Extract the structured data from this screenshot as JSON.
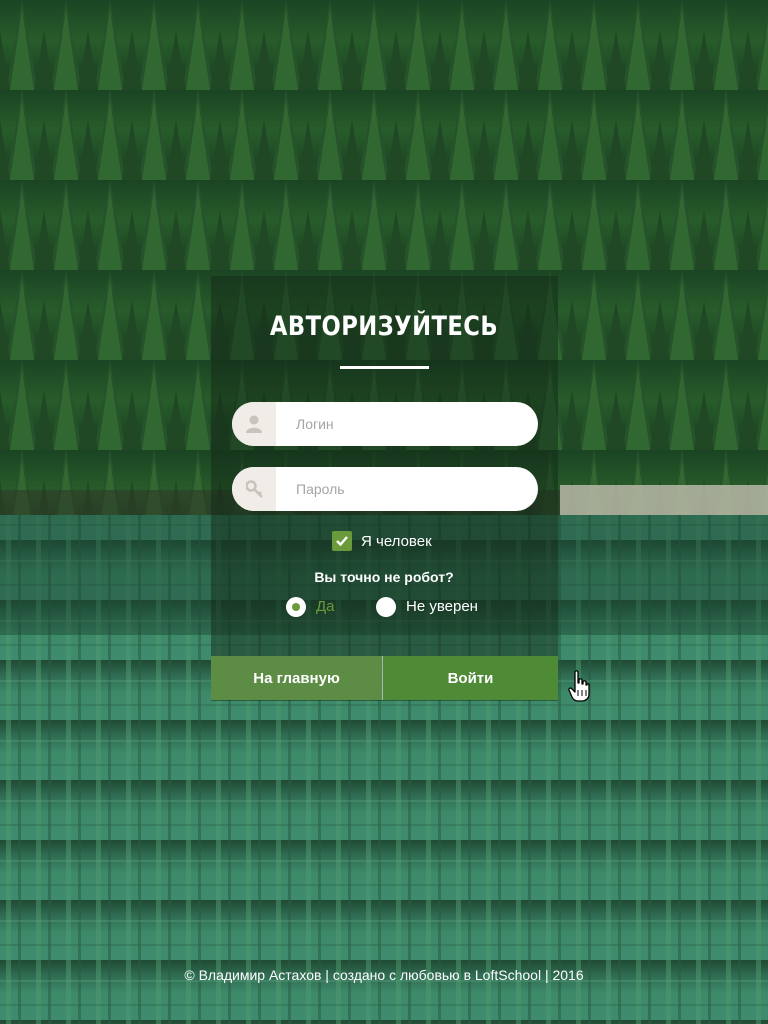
{
  "card": {
    "title": "АВТОРИЗУЙТЕСЬ"
  },
  "login_field": {
    "placeholder": "Логин",
    "value": "",
    "icon": "user-icon"
  },
  "password_field": {
    "placeholder": "Пароль",
    "value": "",
    "icon": "key-icon"
  },
  "human_check": {
    "label": "Я человек",
    "checked": true
  },
  "robot_question": {
    "text": "Вы точно не робот?",
    "options": [
      {
        "label": "Да",
        "selected": true
      },
      {
        "label": "Не уверен",
        "selected": false
      }
    ]
  },
  "buttons": {
    "home_label": "На главную",
    "login_label": "Войти"
  },
  "footer": {
    "text": "© Владимир Астахов | создано с любовью в LoftSchool | 2016"
  },
  "colors": {
    "accent": "#6a9a3a",
    "button_home": "#5d8c45",
    "button_login": "#4f8a37"
  }
}
